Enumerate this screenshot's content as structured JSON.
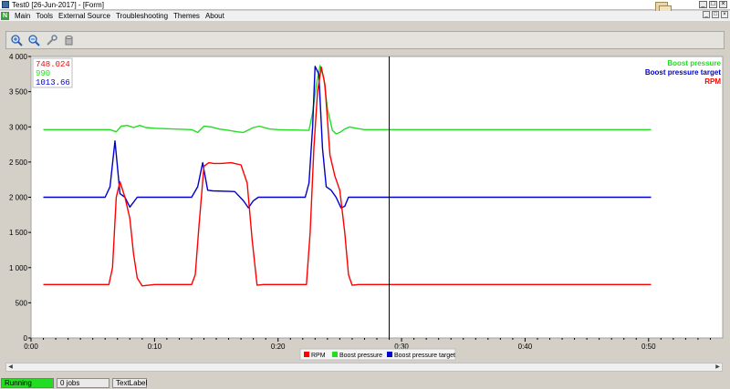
{
  "window": {
    "title": "Test0 [26-Jun-2017] - [Form]"
  },
  "menu": {
    "items": [
      "Main",
      "Tools",
      "External Source",
      "Troubleshooting",
      "Themes",
      "About"
    ],
    "logo_text": "N"
  },
  "toolbar": {
    "icons": [
      "zoom-in-icon",
      "zoom-out-icon",
      "wrench-icon",
      "cylinder-icon"
    ]
  },
  "readout": {
    "rpm": "748.024",
    "boost": "990",
    "target": "1013.66"
  },
  "legend_top": {
    "boost": "Boost pressure",
    "target": "Boost pressure target",
    "rpm": "RPM"
  },
  "legend_bottom": {
    "rpm": "RPM",
    "boost": "Boost pressure",
    "target": "Boost pressure target"
  },
  "colors": {
    "rpm": "#ff0000",
    "boost": "#22dd22",
    "target": "#0000cc"
  },
  "status": {
    "running": "Running",
    "jobs": "0 jobs",
    "label": "TextLabel"
  },
  "chart_data": {
    "type": "line",
    "ylim": [
      0,
      4000
    ],
    "xlim": [
      0,
      56
    ],
    "yticks": [
      0,
      500,
      1000,
      1500,
      2000,
      2500,
      3000,
      3500,
      4000
    ],
    "ytick_labels": [
      "0",
      "500",
      "1 000",
      "1 500",
      "2 000",
      "2 500",
      "3 000",
      "3 500",
      "4 000"
    ],
    "xticks": [
      0,
      10,
      20,
      30,
      40,
      50
    ],
    "xtick_labels": [
      "0:00",
      "0:10",
      "0:20",
      "0:30",
      "0:40",
      "0:50"
    ],
    "cursor_x": 29,
    "series": [
      {
        "name": "Boost pressure",
        "key": "boost",
        "x": [
          1,
          6.4,
          6.9,
          7.3,
          7.8,
          8.3,
          8.8,
          9.3,
          10,
          13,
          13.5,
          14,
          14.6,
          15.2,
          16,
          16.7,
          17.2,
          18,
          18.5,
          19.3,
          20,
          22.5,
          22.8,
          23.1,
          23.4,
          23.7,
          24,
          24.4,
          24.7,
          25,
          25.4,
          25.8,
          26.3,
          27,
          28,
          50.2
        ],
        "values": [
          2960,
          2960,
          2930,
          3010,
          3020,
          2990,
          3020,
          2990,
          2980,
          2960,
          2920,
          3010,
          3000,
          2970,
          2950,
          2930,
          2920,
          2990,
          3010,
          2970,
          2960,
          2950,
          3200,
          3600,
          3870,
          3700,
          3250,
          2950,
          2900,
          2920,
          2970,
          3000,
          2980,
          2960,
          2960,
          2960
        ]
      },
      {
        "name": "Boost pressure target",
        "key": "target",
        "x": [
          1,
          6,
          6.4,
          6.8,
          7.2,
          7.6,
          8,
          8.6,
          9.2,
          10,
          13,
          13.5,
          13.9,
          14.3,
          14.7,
          16.5,
          17.2,
          17.6,
          18,
          18.4,
          19.2,
          20,
          22.2,
          22.5,
          22.8,
          23,
          23.3,
          23.6,
          23.9,
          24.3,
          24.7,
          25.1,
          25.4,
          25.7,
          26,
          26.6,
          28,
          50.2
        ],
        "values": [
          2000,
          2000,
          2150,
          2800,
          2050,
          2000,
          1860,
          2000,
          2000,
          2000,
          2000,
          2150,
          2490,
          2100,
          2090,
          2080,
          1950,
          1850,
          1950,
          2000,
          2000,
          2000,
          2000,
          2200,
          3000,
          3860,
          3750,
          2700,
          2150,
          2100,
          2000,
          1850,
          1870,
          2000,
          2000,
          2000,
          2000,
          2000
        ]
      },
      {
        "name": "RPM",
        "key": "rpm",
        "x": [
          1,
          6.3,
          6.6,
          6.9,
          7.2,
          7.6,
          8,
          8.3,
          8.6,
          9,
          10,
          13,
          13.3,
          13.6,
          14,
          14.4,
          14.8,
          15.4,
          16.2,
          17,
          17.5,
          17.9,
          18.3,
          18.8,
          19.4,
          20,
          22.3,
          22.6,
          22.9,
          23.2,
          23.5,
          23.8,
          24.2,
          24.6,
          25,
          25.4,
          25.7,
          26,
          26.5,
          27,
          28,
          50.2
        ],
        "values": [
          760,
          760,
          1000,
          2000,
          2220,
          2000,
          1700,
          1200,
          850,
          740,
          760,
          760,
          900,
          1600,
          2440,
          2490,
          2480,
          2480,
          2490,
          2460,
          2200,
          1400,
          750,
          760,
          760,
          760,
          760,
          1500,
          2700,
          3500,
          3850,
          3600,
          2600,
          2300,
          2100,
          1500,
          900,
          750,
          760,
          760,
          760,
          760
        ]
      }
    ]
  }
}
